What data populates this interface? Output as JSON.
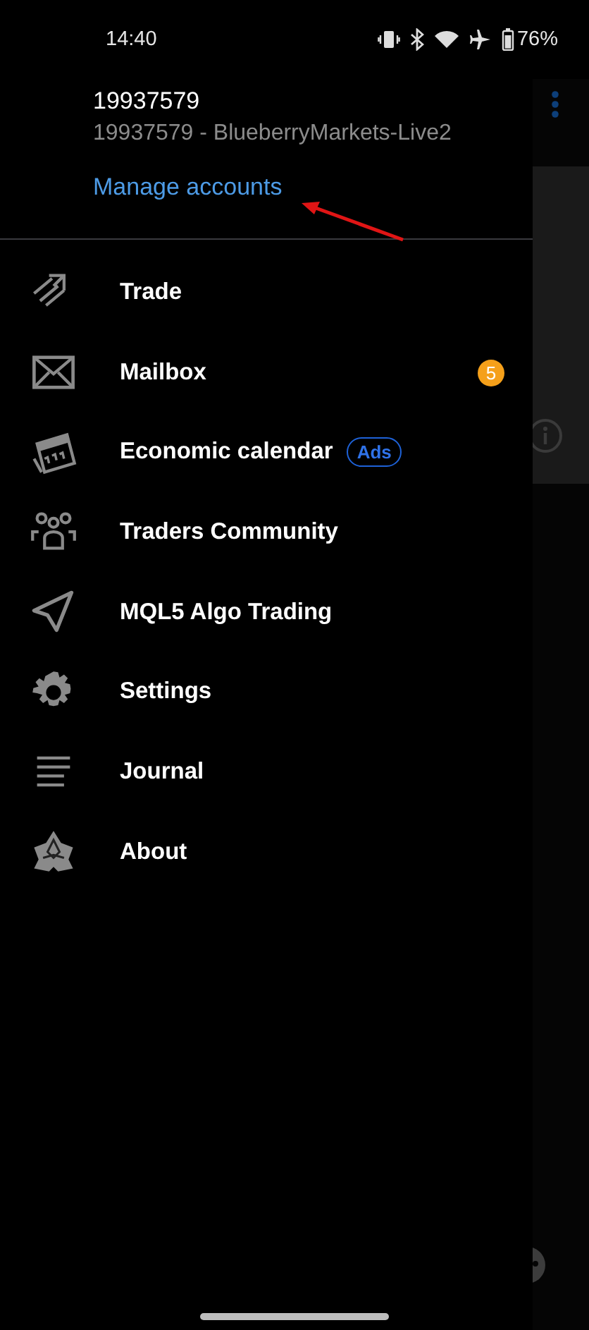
{
  "status_bar": {
    "time": "14:40",
    "battery": "76%"
  },
  "account": {
    "number": "19937579",
    "server": "19937579 - BlueberryMarkets-Live2",
    "manage_link": "Manage accounts"
  },
  "menu": [
    {
      "kind": "trade",
      "label": "Trade"
    },
    {
      "kind": "mail",
      "label": "Mailbox",
      "badge": "5"
    },
    {
      "kind": "calendar",
      "label": "Economic calendar",
      "tag": "Ads"
    },
    {
      "kind": "community",
      "label": "Traders Community"
    },
    {
      "kind": "send",
      "label": "MQL5 Algo Trading"
    },
    {
      "kind": "settings",
      "label": "Settings"
    },
    {
      "kind": "journal",
      "label": "Journal"
    },
    {
      "kind": "about",
      "label": "About"
    }
  ]
}
